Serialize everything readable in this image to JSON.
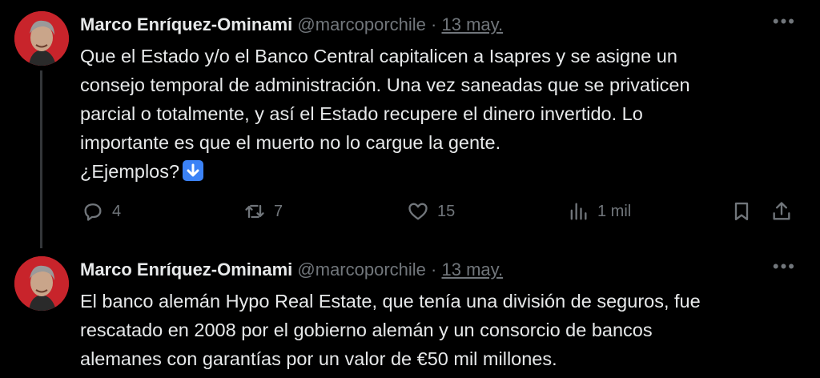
{
  "tweets": [
    {
      "author_name": "Marco Enríquez-Ominami",
      "handle": "@marcoporchile",
      "separator": "·",
      "date": "13 may.",
      "text_lines": [
        "Que el Estado y/o el Banco Central capitalicen a Isapres y se asigne un",
        "consejo temporal de administración. Una vez saneadas que se privaticen",
        "parcial o totalmente, y así el Estado recupere el dinero invertido.  Lo",
        "importante es que el muerto no lo cargue la gente.",
        "¿Ejemplos?"
      ],
      "emoji": "down-arrow-emoji",
      "actions": {
        "replies": "4",
        "reposts": "7",
        "likes": "15",
        "views": "1 mil"
      }
    },
    {
      "author_name": "Marco Enríquez-Ominami",
      "handle": "@marcoporchile",
      "separator": "·",
      "date": "13 may.",
      "text_lines": [
        "El banco alemán Hypo Real Estate, que tenía una división de seguros, fue",
        "rescatado en 2008 por el gobierno alemán y un consorcio de bancos",
        "alemanes con garantías por un valor de €50 mil millones."
      ]
    }
  ],
  "more_icon": "more-horizontal-icon",
  "colors": {
    "background": "#000000",
    "text": "#e7e9ea",
    "muted": "#71767b",
    "avatar_bg": "#c8242b",
    "emoji_bg": "#3b82f6"
  }
}
